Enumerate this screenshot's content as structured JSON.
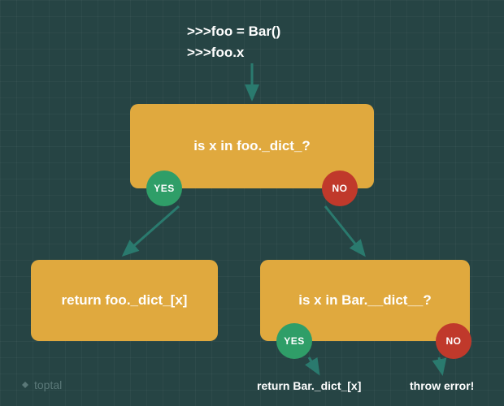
{
  "header": {
    "line1": ">>>foo = Bar()",
    "line2": ">>>foo.x"
  },
  "boxes": {
    "q1": "is x in foo._dict_?",
    "result_left": "return foo._dict_[x]",
    "q2": "is x in Bar.__dict__?"
  },
  "badges": {
    "yes": "YES",
    "no": "NO"
  },
  "bottom": {
    "left": "return Bar._dict_[x]",
    "right": "throw error!"
  },
  "brand": "toptal",
  "colors": {
    "bg": "#264444",
    "box": "#e0a93e",
    "yes": "#2f9e68",
    "no": "#c0392b",
    "arrow": "#2a7a6e"
  }
}
